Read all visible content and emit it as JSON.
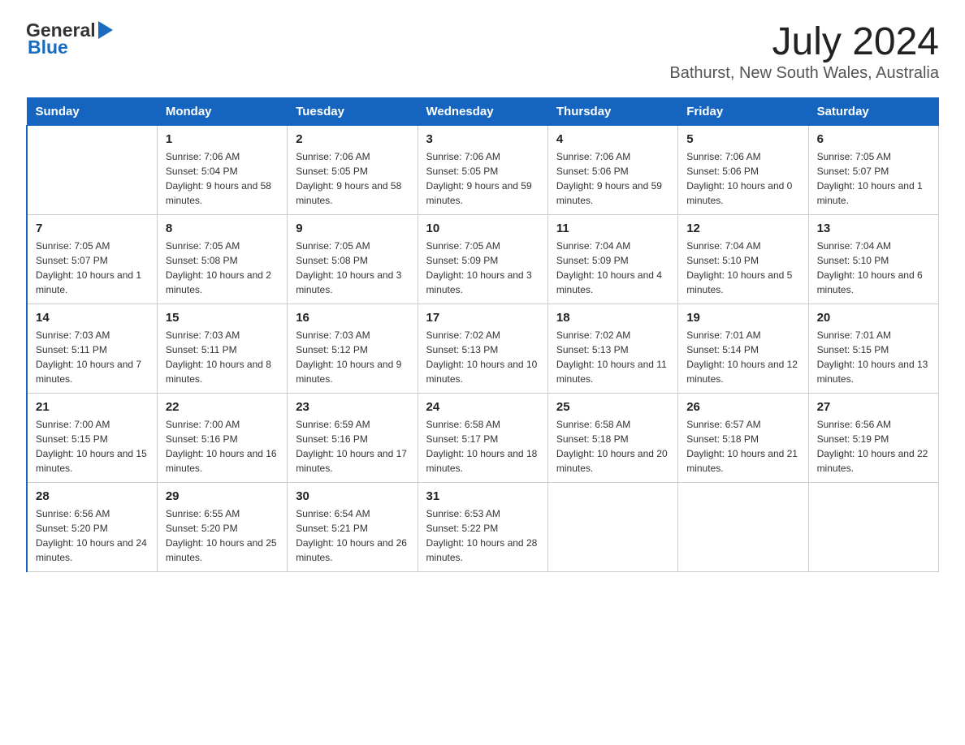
{
  "header": {
    "title": "July 2024",
    "subtitle": "Bathurst, New South Wales, Australia",
    "logo_general": "General",
    "logo_blue": "Blue"
  },
  "calendar": {
    "days": [
      "Sunday",
      "Monday",
      "Tuesday",
      "Wednesday",
      "Thursday",
      "Friday",
      "Saturday"
    ],
    "weeks": [
      [
        {
          "day": "",
          "sunrise": "",
          "sunset": "",
          "daylight": ""
        },
        {
          "day": "1",
          "sunrise": "Sunrise: 7:06 AM",
          "sunset": "Sunset: 5:04 PM",
          "daylight": "Daylight: 9 hours and 58 minutes."
        },
        {
          "day": "2",
          "sunrise": "Sunrise: 7:06 AM",
          "sunset": "Sunset: 5:05 PM",
          "daylight": "Daylight: 9 hours and 58 minutes."
        },
        {
          "day": "3",
          "sunrise": "Sunrise: 7:06 AM",
          "sunset": "Sunset: 5:05 PM",
          "daylight": "Daylight: 9 hours and 59 minutes."
        },
        {
          "day": "4",
          "sunrise": "Sunrise: 7:06 AM",
          "sunset": "Sunset: 5:06 PM",
          "daylight": "Daylight: 9 hours and 59 minutes."
        },
        {
          "day": "5",
          "sunrise": "Sunrise: 7:06 AM",
          "sunset": "Sunset: 5:06 PM",
          "daylight": "Daylight: 10 hours and 0 minutes."
        },
        {
          "day": "6",
          "sunrise": "Sunrise: 7:05 AM",
          "sunset": "Sunset: 5:07 PM",
          "daylight": "Daylight: 10 hours and 1 minute."
        }
      ],
      [
        {
          "day": "7",
          "sunrise": "Sunrise: 7:05 AM",
          "sunset": "Sunset: 5:07 PM",
          "daylight": "Daylight: 10 hours and 1 minute."
        },
        {
          "day": "8",
          "sunrise": "Sunrise: 7:05 AM",
          "sunset": "Sunset: 5:08 PM",
          "daylight": "Daylight: 10 hours and 2 minutes."
        },
        {
          "day": "9",
          "sunrise": "Sunrise: 7:05 AM",
          "sunset": "Sunset: 5:08 PM",
          "daylight": "Daylight: 10 hours and 3 minutes."
        },
        {
          "day": "10",
          "sunrise": "Sunrise: 7:05 AM",
          "sunset": "Sunset: 5:09 PM",
          "daylight": "Daylight: 10 hours and 3 minutes."
        },
        {
          "day": "11",
          "sunrise": "Sunrise: 7:04 AM",
          "sunset": "Sunset: 5:09 PM",
          "daylight": "Daylight: 10 hours and 4 minutes."
        },
        {
          "day": "12",
          "sunrise": "Sunrise: 7:04 AM",
          "sunset": "Sunset: 5:10 PM",
          "daylight": "Daylight: 10 hours and 5 minutes."
        },
        {
          "day": "13",
          "sunrise": "Sunrise: 7:04 AM",
          "sunset": "Sunset: 5:10 PM",
          "daylight": "Daylight: 10 hours and 6 minutes."
        }
      ],
      [
        {
          "day": "14",
          "sunrise": "Sunrise: 7:03 AM",
          "sunset": "Sunset: 5:11 PM",
          "daylight": "Daylight: 10 hours and 7 minutes."
        },
        {
          "day": "15",
          "sunrise": "Sunrise: 7:03 AM",
          "sunset": "Sunset: 5:11 PM",
          "daylight": "Daylight: 10 hours and 8 minutes."
        },
        {
          "day": "16",
          "sunrise": "Sunrise: 7:03 AM",
          "sunset": "Sunset: 5:12 PM",
          "daylight": "Daylight: 10 hours and 9 minutes."
        },
        {
          "day": "17",
          "sunrise": "Sunrise: 7:02 AM",
          "sunset": "Sunset: 5:13 PM",
          "daylight": "Daylight: 10 hours and 10 minutes."
        },
        {
          "day": "18",
          "sunrise": "Sunrise: 7:02 AM",
          "sunset": "Sunset: 5:13 PM",
          "daylight": "Daylight: 10 hours and 11 minutes."
        },
        {
          "day": "19",
          "sunrise": "Sunrise: 7:01 AM",
          "sunset": "Sunset: 5:14 PM",
          "daylight": "Daylight: 10 hours and 12 minutes."
        },
        {
          "day": "20",
          "sunrise": "Sunrise: 7:01 AM",
          "sunset": "Sunset: 5:15 PM",
          "daylight": "Daylight: 10 hours and 13 minutes."
        }
      ],
      [
        {
          "day": "21",
          "sunrise": "Sunrise: 7:00 AM",
          "sunset": "Sunset: 5:15 PM",
          "daylight": "Daylight: 10 hours and 15 minutes."
        },
        {
          "day": "22",
          "sunrise": "Sunrise: 7:00 AM",
          "sunset": "Sunset: 5:16 PM",
          "daylight": "Daylight: 10 hours and 16 minutes."
        },
        {
          "day": "23",
          "sunrise": "Sunrise: 6:59 AM",
          "sunset": "Sunset: 5:16 PM",
          "daylight": "Daylight: 10 hours and 17 minutes."
        },
        {
          "day": "24",
          "sunrise": "Sunrise: 6:58 AM",
          "sunset": "Sunset: 5:17 PM",
          "daylight": "Daylight: 10 hours and 18 minutes."
        },
        {
          "day": "25",
          "sunrise": "Sunrise: 6:58 AM",
          "sunset": "Sunset: 5:18 PM",
          "daylight": "Daylight: 10 hours and 20 minutes."
        },
        {
          "day": "26",
          "sunrise": "Sunrise: 6:57 AM",
          "sunset": "Sunset: 5:18 PM",
          "daylight": "Daylight: 10 hours and 21 minutes."
        },
        {
          "day": "27",
          "sunrise": "Sunrise: 6:56 AM",
          "sunset": "Sunset: 5:19 PM",
          "daylight": "Daylight: 10 hours and 22 minutes."
        }
      ],
      [
        {
          "day": "28",
          "sunrise": "Sunrise: 6:56 AM",
          "sunset": "Sunset: 5:20 PM",
          "daylight": "Daylight: 10 hours and 24 minutes."
        },
        {
          "day": "29",
          "sunrise": "Sunrise: 6:55 AM",
          "sunset": "Sunset: 5:20 PM",
          "daylight": "Daylight: 10 hours and 25 minutes."
        },
        {
          "day": "30",
          "sunrise": "Sunrise: 6:54 AM",
          "sunset": "Sunset: 5:21 PM",
          "daylight": "Daylight: 10 hours and 26 minutes."
        },
        {
          "day": "31",
          "sunrise": "Sunrise: 6:53 AM",
          "sunset": "Sunset: 5:22 PM",
          "daylight": "Daylight: 10 hours and 28 minutes."
        },
        {
          "day": "",
          "sunrise": "",
          "sunset": "",
          "daylight": ""
        },
        {
          "day": "",
          "sunrise": "",
          "sunset": "",
          "daylight": ""
        },
        {
          "day": "",
          "sunrise": "",
          "sunset": "",
          "daylight": ""
        }
      ]
    ]
  }
}
